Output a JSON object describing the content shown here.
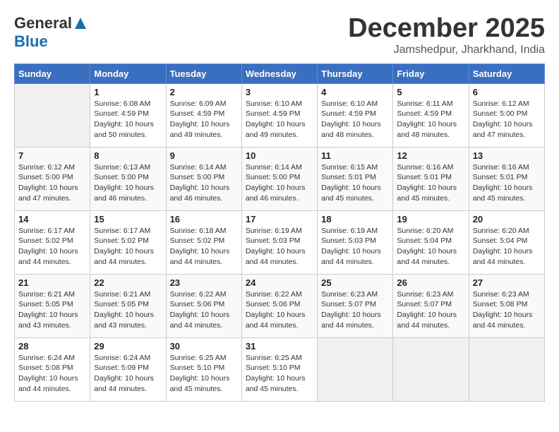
{
  "logo": {
    "general": "General",
    "blue": "Blue"
  },
  "title": {
    "month": "December 2025",
    "location": "Jamshedpur, Jharkhand, India"
  },
  "headers": [
    "Sunday",
    "Monday",
    "Tuesday",
    "Wednesday",
    "Thursday",
    "Friday",
    "Saturday"
  ],
  "weeks": [
    [
      {
        "day": "",
        "info": ""
      },
      {
        "day": "1",
        "info": "Sunrise: 6:08 AM\nSunset: 4:59 PM\nDaylight: 10 hours\nand 50 minutes."
      },
      {
        "day": "2",
        "info": "Sunrise: 6:09 AM\nSunset: 4:59 PM\nDaylight: 10 hours\nand 49 minutes."
      },
      {
        "day": "3",
        "info": "Sunrise: 6:10 AM\nSunset: 4:59 PM\nDaylight: 10 hours\nand 49 minutes."
      },
      {
        "day": "4",
        "info": "Sunrise: 6:10 AM\nSunset: 4:59 PM\nDaylight: 10 hours\nand 48 minutes."
      },
      {
        "day": "5",
        "info": "Sunrise: 6:11 AM\nSunset: 4:59 PM\nDaylight: 10 hours\nand 48 minutes."
      },
      {
        "day": "6",
        "info": "Sunrise: 6:12 AM\nSunset: 5:00 PM\nDaylight: 10 hours\nand 47 minutes."
      }
    ],
    [
      {
        "day": "7",
        "info": "Sunrise: 6:12 AM\nSunset: 5:00 PM\nDaylight: 10 hours\nand 47 minutes."
      },
      {
        "day": "8",
        "info": "Sunrise: 6:13 AM\nSunset: 5:00 PM\nDaylight: 10 hours\nand 46 minutes."
      },
      {
        "day": "9",
        "info": "Sunrise: 6:14 AM\nSunset: 5:00 PM\nDaylight: 10 hours\nand 46 minutes."
      },
      {
        "day": "10",
        "info": "Sunrise: 6:14 AM\nSunset: 5:00 PM\nDaylight: 10 hours\nand 46 minutes."
      },
      {
        "day": "11",
        "info": "Sunrise: 6:15 AM\nSunset: 5:01 PM\nDaylight: 10 hours\nand 45 minutes."
      },
      {
        "day": "12",
        "info": "Sunrise: 6:16 AM\nSunset: 5:01 PM\nDaylight: 10 hours\nand 45 minutes."
      },
      {
        "day": "13",
        "info": "Sunrise: 6:16 AM\nSunset: 5:01 PM\nDaylight: 10 hours\nand 45 minutes."
      }
    ],
    [
      {
        "day": "14",
        "info": "Sunrise: 6:17 AM\nSunset: 5:02 PM\nDaylight: 10 hours\nand 44 minutes."
      },
      {
        "day": "15",
        "info": "Sunrise: 6:17 AM\nSunset: 5:02 PM\nDaylight: 10 hours\nand 44 minutes."
      },
      {
        "day": "16",
        "info": "Sunrise: 6:18 AM\nSunset: 5:02 PM\nDaylight: 10 hours\nand 44 minutes."
      },
      {
        "day": "17",
        "info": "Sunrise: 6:19 AM\nSunset: 5:03 PM\nDaylight: 10 hours\nand 44 minutes."
      },
      {
        "day": "18",
        "info": "Sunrise: 6:19 AM\nSunset: 5:03 PM\nDaylight: 10 hours\nand 44 minutes."
      },
      {
        "day": "19",
        "info": "Sunrise: 6:20 AM\nSunset: 5:04 PM\nDaylight: 10 hours\nand 44 minutes."
      },
      {
        "day": "20",
        "info": "Sunrise: 6:20 AM\nSunset: 5:04 PM\nDaylight: 10 hours\nand 44 minutes."
      }
    ],
    [
      {
        "day": "21",
        "info": "Sunrise: 6:21 AM\nSunset: 5:05 PM\nDaylight: 10 hours\nand 43 minutes."
      },
      {
        "day": "22",
        "info": "Sunrise: 6:21 AM\nSunset: 5:05 PM\nDaylight: 10 hours\nand 43 minutes."
      },
      {
        "day": "23",
        "info": "Sunrise: 6:22 AM\nSunset: 5:06 PM\nDaylight: 10 hours\nand 44 minutes."
      },
      {
        "day": "24",
        "info": "Sunrise: 6:22 AM\nSunset: 5:06 PM\nDaylight: 10 hours\nand 44 minutes."
      },
      {
        "day": "25",
        "info": "Sunrise: 6:23 AM\nSunset: 5:07 PM\nDaylight: 10 hours\nand 44 minutes."
      },
      {
        "day": "26",
        "info": "Sunrise: 6:23 AM\nSunset: 5:07 PM\nDaylight: 10 hours\nand 44 minutes."
      },
      {
        "day": "27",
        "info": "Sunrise: 6:23 AM\nSunset: 5:08 PM\nDaylight: 10 hours\nand 44 minutes."
      }
    ],
    [
      {
        "day": "28",
        "info": "Sunrise: 6:24 AM\nSunset: 5:08 PM\nDaylight: 10 hours\nand 44 minutes."
      },
      {
        "day": "29",
        "info": "Sunrise: 6:24 AM\nSunset: 5:09 PM\nDaylight: 10 hours\nand 44 minutes."
      },
      {
        "day": "30",
        "info": "Sunrise: 6:25 AM\nSunset: 5:10 PM\nDaylight: 10 hours\nand 45 minutes."
      },
      {
        "day": "31",
        "info": "Sunrise: 6:25 AM\nSunset: 5:10 PM\nDaylight: 10 hours\nand 45 minutes."
      },
      {
        "day": "",
        "info": ""
      },
      {
        "day": "",
        "info": ""
      },
      {
        "day": "",
        "info": ""
      }
    ]
  ]
}
